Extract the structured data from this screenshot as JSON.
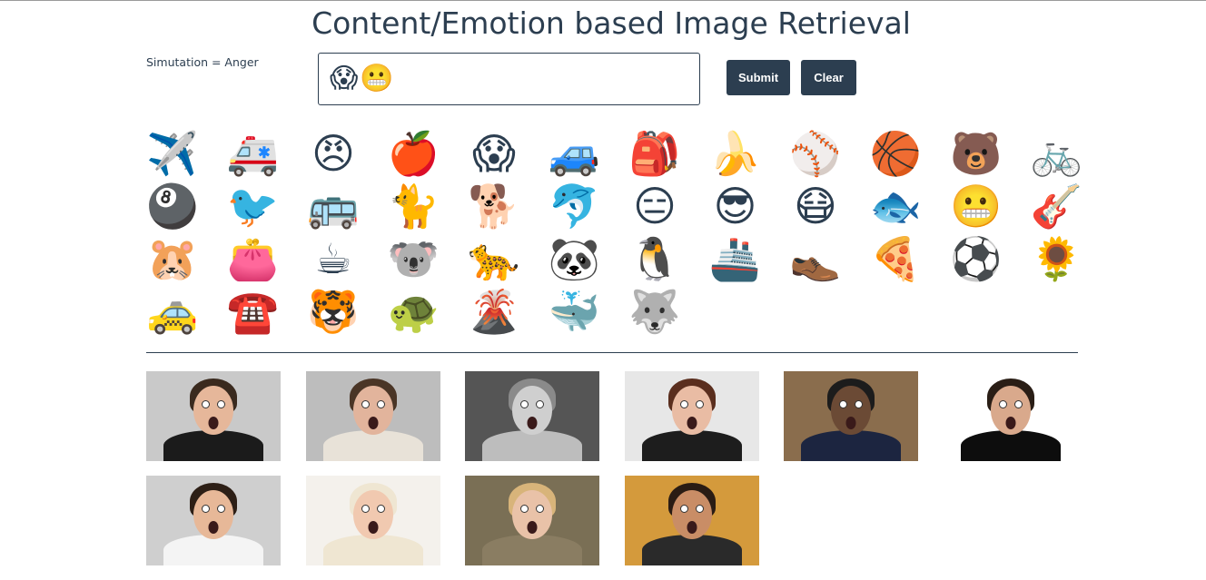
{
  "title": "Content/Emotion based Image Retrieval",
  "simulation_label": "Simutation = Anger",
  "query": {
    "emojis": [
      "😱",
      "😬"
    ]
  },
  "buttons": {
    "submit": "Submit",
    "clear": "Clear"
  },
  "emoji_palette": [
    {
      "name": "airplane-icon",
      "char": "✈️"
    },
    {
      "name": "ambulance-icon",
      "char": "🚑"
    },
    {
      "name": "angry-face-icon",
      "char": "😠"
    },
    {
      "name": "apple-icon",
      "char": "🍎"
    },
    {
      "name": "screaming-face-icon",
      "char": "😱"
    },
    {
      "name": "car-icon",
      "char": "🚙"
    },
    {
      "name": "backpack-icon",
      "char": "🎒"
    },
    {
      "name": "banana-icon",
      "char": "🍌"
    },
    {
      "name": "baseball-icon",
      "char": "⚾"
    },
    {
      "name": "basketball-hoop-icon",
      "char": "🏀"
    },
    {
      "name": "bear-icon",
      "char": "🐻"
    },
    {
      "name": "bicycle-icon",
      "char": "🚲"
    },
    {
      "name": "billiards-icon",
      "char": "🎱"
    },
    {
      "name": "bird-icon",
      "char": "🐦"
    },
    {
      "name": "bus-icon",
      "char": "🚌"
    },
    {
      "name": "cat-icon",
      "char": "🐈"
    },
    {
      "name": "dog-icon",
      "char": "🐕"
    },
    {
      "name": "dolphin-icon",
      "char": "🐬"
    },
    {
      "name": "expressionless-face-icon",
      "char": "😑"
    },
    {
      "name": "sunglasses-face-icon",
      "char": "😎"
    },
    {
      "name": "mask-face-icon",
      "char": "😷"
    },
    {
      "name": "fish-icon",
      "char": "🐟"
    },
    {
      "name": "grimacing-face-icon",
      "char": "😬"
    },
    {
      "name": "guitar-icon",
      "char": "🎸"
    },
    {
      "name": "hamster-icon",
      "char": "🐹"
    },
    {
      "name": "purse-icon",
      "char": "👛"
    },
    {
      "name": "coffee-icon",
      "char": "☕"
    },
    {
      "name": "koala-icon",
      "char": "🐨"
    },
    {
      "name": "leopard-icon",
      "char": "🐆"
    },
    {
      "name": "panda-icon",
      "char": "🐼"
    },
    {
      "name": "penguin-icon",
      "char": "🐧"
    },
    {
      "name": "ship-icon",
      "char": "🚢"
    },
    {
      "name": "shoe-icon",
      "char": "👞"
    },
    {
      "name": "pizza-icon",
      "char": "🍕"
    },
    {
      "name": "soccer-ball-icon",
      "char": "⚽"
    },
    {
      "name": "sunflower-icon",
      "char": "🌻"
    },
    {
      "name": "taxi-icon",
      "char": "🚕"
    },
    {
      "name": "telephone-icon",
      "char": "☎️"
    },
    {
      "name": "tiger-icon",
      "char": "🐯"
    },
    {
      "name": "turtle-icon",
      "char": "🐢"
    },
    {
      "name": "volcano-icon",
      "char": "🌋"
    },
    {
      "name": "whale-icon",
      "char": "🐳"
    },
    {
      "name": "wolf-icon",
      "char": "🐺"
    }
  ],
  "results": [
    {
      "name": "result-man-surprised-1",
      "bg": "#c9c9c9",
      "skin": "#e6b79a",
      "hair": "#3a2a1e",
      "shirt": "#1b1b1b"
    },
    {
      "name": "result-woman-surprised-1",
      "bg": "#bdbdbd",
      "skin": "#e2b49c",
      "hair": "#4a3526",
      "shirt": "#e8e2d8"
    },
    {
      "name": "result-baby-bw",
      "bg": "#555555",
      "skin": "#cfcfcf",
      "hair": "#8a8a8a",
      "shirt": "#bdbdbd"
    },
    {
      "name": "result-woman-surprised-2",
      "bg": "#e7e7e7",
      "skin": "#e9bca4",
      "hair": "#5a2e1e",
      "shirt": "#1d1d1d"
    },
    {
      "name": "result-man-library",
      "bg": "#8a6d4d",
      "skin": "#6b4a35",
      "hair": "#1c1c1c",
      "shirt": "#1c2540"
    },
    {
      "name": "result-man-surprised-2",
      "bg": "#ffffff",
      "skin": "#d9a98c",
      "hair": "#2a1e16",
      "shirt": "#0d0d0d"
    },
    {
      "name": "result-man-tie",
      "bg": "#cfcfcf",
      "skin": "#e7b898",
      "hair": "#2d1f16",
      "shirt": "#f4f4f4"
    },
    {
      "name": "result-baby-blanket",
      "bg": "#f4f1ec",
      "skin": "#f1c9b0",
      "hair": "#efe6d2",
      "shirt": "#efe6d2"
    },
    {
      "name": "result-girl-glasses",
      "bg": "#7a6f55",
      "skin": "#e9c2a8",
      "hair": "#d8b47a",
      "shirt": "#8a7d62"
    },
    {
      "name": "result-man-laughing",
      "bg": "#d49a3c",
      "skin": "#c98d66",
      "hair": "#2a1c14",
      "shirt": "#2a2a2a"
    }
  ]
}
